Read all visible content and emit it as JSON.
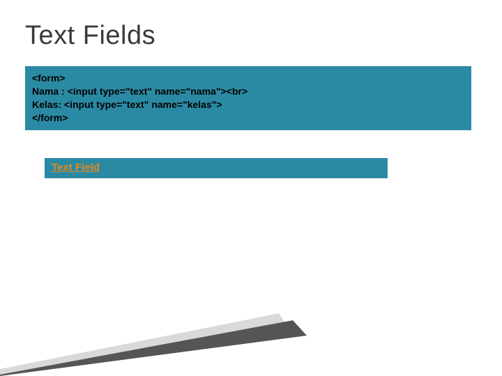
{
  "title": "Text Fields",
  "code": {
    "line1": "<form>",
    "line2": "Nama : <input type=\"text\" name=\"nama\"><br>",
    "line3": "Kelas: <input type=\"text\" name=\"kelas\">",
    "line4": "</form>"
  },
  "link": {
    "label": "Text Field"
  }
}
